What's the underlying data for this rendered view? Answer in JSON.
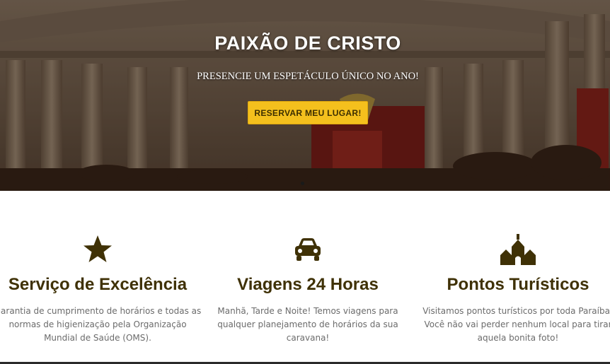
{
  "hero": {
    "title": "PAIXÃO DE CRISTO",
    "subtitle": "PRESENCIE UM ESPETÁCULO ÚNICO NO ANO!",
    "button_label": "RESERVAR MEU LUGAR!",
    "button_color": "#f4c01d"
  },
  "features": [
    {
      "icon": "star-icon",
      "title": "Serviço de Excelência",
      "text": "Garantia de cumprimento de horários e todas as normas de higienização pela Organização Mundial de Saúde (OMS)."
    },
    {
      "icon": "car-icon",
      "title": "Viagens 24 Horas",
      "text": "Manhã, Tarde e Noite! Temos viagens para qualquer planejamento de horários da sua caravana!"
    },
    {
      "icon": "church-icon",
      "title": "Pontos Turísticos",
      "text": "Visitamos pontos turísticos por toda Paraíba! Você não vai perder nenhum local para tirar aquela bonita foto!"
    }
  ],
  "colors": {
    "accent": "#f4c01d",
    "heading": "#3f3106",
    "body_text": "#6b6b6b"
  }
}
